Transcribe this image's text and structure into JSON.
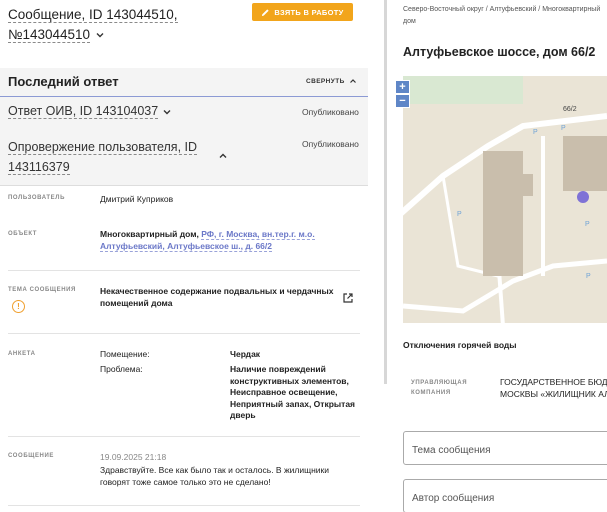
{
  "header": {
    "title_line1": "Сообщение, ID 143044510,",
    "title_line2": "№143044510",
    "take_button": "ВЗЯТЬ В РАБОТУ"
  },
  "last_reply": {
    "heading": "Последний ответ",
    "collapse_label": "СВЕРНУТЬ",
    "items": [
      {
        "title": "Ответ ОИВ, ID 143104037",
        "status": "Опубликовано"
      },
      {
        "title_line1": "Опровержение пользователя, ID",
        "title_line2": "143116379",
        "status": "Опубликовано"
      }
    ]
  },
  "details": {
    "user_label": "ПОЛЬЗОВАТЕЛЬ",
    "user_value": "Дмитрий Куприков",
    "object_label": "ОБЪЕКТ",
    "object_type": "Многоквартирный дом, ",
    "object_link": "РФ, г. Москва, вн.тер.г. м.о. Алтуфьевский, Алтуфьевское ш., д. 66/2",
    "topic_label": "ТЕМА СООБЩЕНИЯ",
    "topic_value": "Некачественное содержание подвальных и чердачных помещений дома",
    "form_label": "АНКЕТА",
    "form_room_key": "Помещение:",
    "form_room_val": "Чердак",
    "form_problem_key": "Проблема:",
    "form_problem_val": "Наличие повреждений конструктивных элементов, Неисправное освещение, Неприятный запах, Открытая дверь",
    "message_label": "СООБЩЕНИЕ",
    "message_date": "19.09.2025 21:18",
    "message_text": "Здравствуйте. Все как было так и осталось. В жилищники говорят тоже самое только это не сделано!"
  },
  "right": {
    "breadcrumb": "Северо-Восточный округ / Алтуфьевский / Многоквартирный дом",
    "address": "Алтуфьевское шоссе, дом 66/2",
    "map_house_label": "66/2",
    "zoom_in": "+",
    "zoom_out": "−",
    "hot_water": "Отключения горячей воды",
    "company_label": "УПРАВЛЯЮЩАЯ КОМПАНИЯ",
    "company_value_line1": "ГОСУДАРСТВЕННОЕ БЮДЖ",
    "company_value_line2": "МОСКВЫ «ЖИЛИЩНИК АЛ",
    "field_topic": "Тема сообщения",
    "field_author": "Автор сообщения"
  },
  "colors": {
    "accent": "#f2a51b",
    "link": "#6b78c8",
    "map_marker": "#7f72d6"
  }
}
